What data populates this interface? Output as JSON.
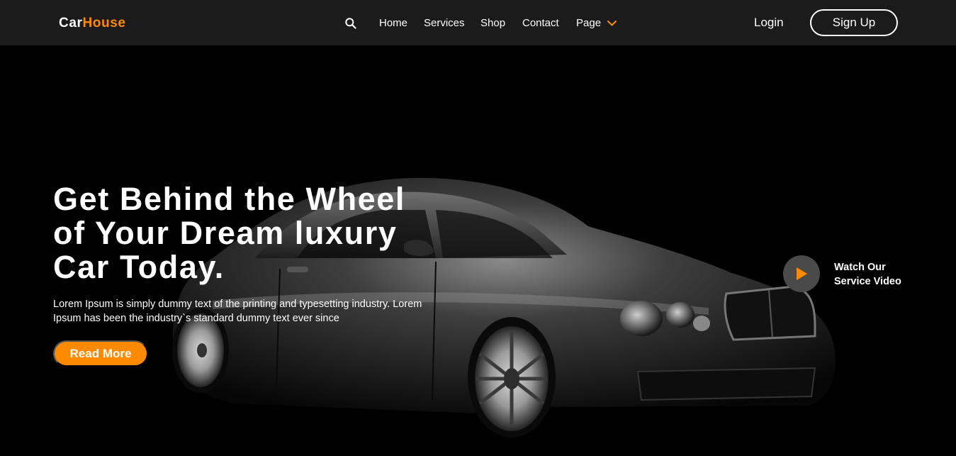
{
  "brand": {
    "part1": "Car",
    "part2": "House",
    "accent": "#ff8a00"
  },
  "nav": {
    "search_icon": "search-icon",
    "links": [
      "Home",
      "Services",
      "Shop",
      "Contact"
    ],
    "page_label": "Page",
    "page_icon": "chevron-down-icon"
  },
  "auth": {
    "login": "Login",
    "signup": "Sign Up"
  },
  "hero": {
    "headline_lines": [
      "Get Behind the Wheel",
      "of Your Dream luxury",
      "Car Today."
    ],
    "description_lines": [
      "Lorem Ipsum is simply dummy text of the printing and typesetting industry. Lorem",
      "Ipsum has been the industry`s standard dummy text ever since"
    ],
    "cta": "Read More",
    "video_icon": "play-icon",
    "video_lines": [
      "Watch Our",
      "Service Video"
    ]
  },
  "colors": {
    "navbar": "#1c1b1c",
    "background": "#000000",
    "accent": "#ff8a00",
    "play_bg": "#4a4a4a"
  }
}
